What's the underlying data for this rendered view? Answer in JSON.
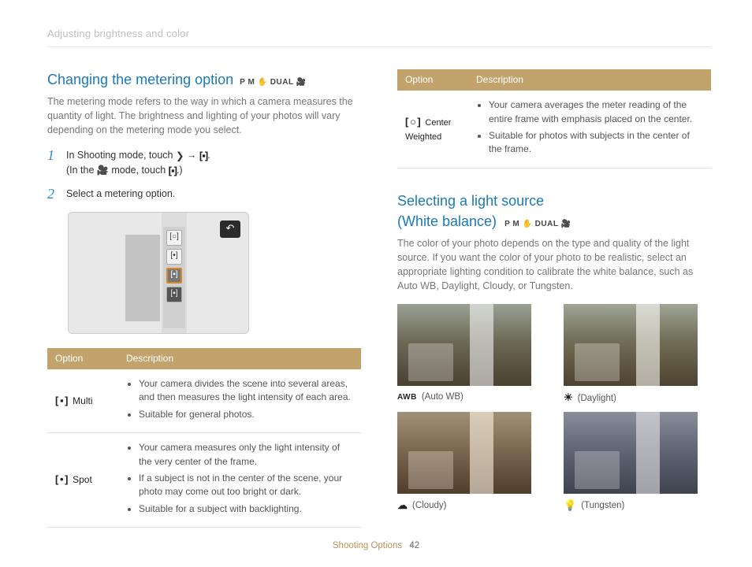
{
  "breadcrumb": "Adjusting brightness and color",
  "footer": {
    "section": "Shooting Options",
    "page": "42"
  },
  "left": {
    "heading": "Changing the metering option",
    "modes": "P M ✋ DUAL 🎥",
    "intro": "The metering mode refers to the way in which a camera measures the quantity of light. The brightness and lighting of your photos will vary depending on the metering mode you select.",
    "steps": {
      "s1a": "In Shooting mode, touch ",
      "s1_arrow": " → ",
      "s1b": ".",
      "s1_line2a": "(In the ",
      "s1_line2b": " mode, touch ",
      "s1_line2c": ".)",
      "s2": "Select a metering option."
    },
    "table": {
      "h1": "Option",
      "h2": "Description",
      "rows": [
        {
          "icon": "[ ▪ ]",
          "name": "Multi",
          "bullets": [
            "Your camera divides the scene into several areas, and then measures the light intensity of each area.",
            "Suitable for general photos."
          ]
        },
        {
          "icon": "[ • ]",
          "name": "Spot",
          "bullets": [
            "Your camera measures only the light intensity of the very center of the frame.",
            "If a subject is not in the center of the scene, your photo may come out too bright or dark.",
            "Suitable for a subject with backlighting."
          ]
        }
      ]
    }
  },
  "right": {
    "table": {
      "h1": "Option",
      "h2": "Description",
      "row": {
        "icon": "[ ○ ]",
        "name": "Center Weighted",
        "bullets": [
          "Your camera averages the meter reading of the entire frame with emphasis placed on the center.",
          "Suitable for photos with subjects in the center of the frame."
        ]
      }
    },
    "heading1": "Selecting a light source",
    "heading2": "(White balance)",
    "modes": "P M ✋ DUAL 🎥",
    "intro": "The color of your photo depends on the type and quality of the light source. If you want the color of your photo to be realistic, select an appropriate lighting condition to calibrate the white balance, such as Auto WB, Daylight, Cloudy, or Tungsten.",
    "wb": {
      "awb_icon": "AWB",
      "awb": "(Auto WB)",
      "day_icon": "☀",
      "day": "(Daylight)",
      "cloud_icon": "☁",
      "cloud": "(Cloudy)",
      "tung_icon": "💡",
      "tung": "(Tungsten)"
    }
  }
}
